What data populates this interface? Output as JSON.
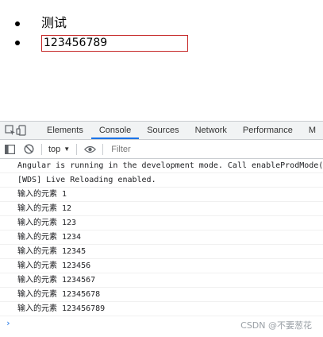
{
  "app": {
    "items": [
      {
        "text": "测试"
      },
      {
        "input_value": "123456789"
      }
    ]
  },
  "devtools": {
    "tabs": [
      "Elements",
      "Console",
      "Sources",
      "Network",
      "Performance",
      "M"
    ],
    "active_tab": "Console",
    "context": "top",
    "filter_placeholder": "Filter",
    "messages": [
      {
        "text": "Angular is running in the development mode. Call enableProdMode()"
      },
      {
        "text": "[WDS] Live Reloading enabled."
      },
      {
        "label": "输入的元素",
        "value": "1"
      },
      {
        "label": "输入的元素",
        "value": "12"
      },
      {
        "label": "输入的元素",
        "value": "123"
      },
      {
        "label": "输入的元素",
        "value": "1234"
      },
      {
        "label": "输入的元素",
        "value": "12345"
      },
      {
        "label": "输入的元素",
        "value": "123456"
      },
      {
        "label": "输入的元素",
        "value": "1234567"
      },
      {
        "label": "输入的元素",
        "value": "12345678"
      },
      {
        "label": "输入的元素",
        "value": "123456789"
      }
    ],
    "prompt": "›"
  },
  "watermark": "CSDN @不要葱花",
  "colors": {
    "accent": "#1a73e8",
    "input_border": "#c62828"
  }
}
